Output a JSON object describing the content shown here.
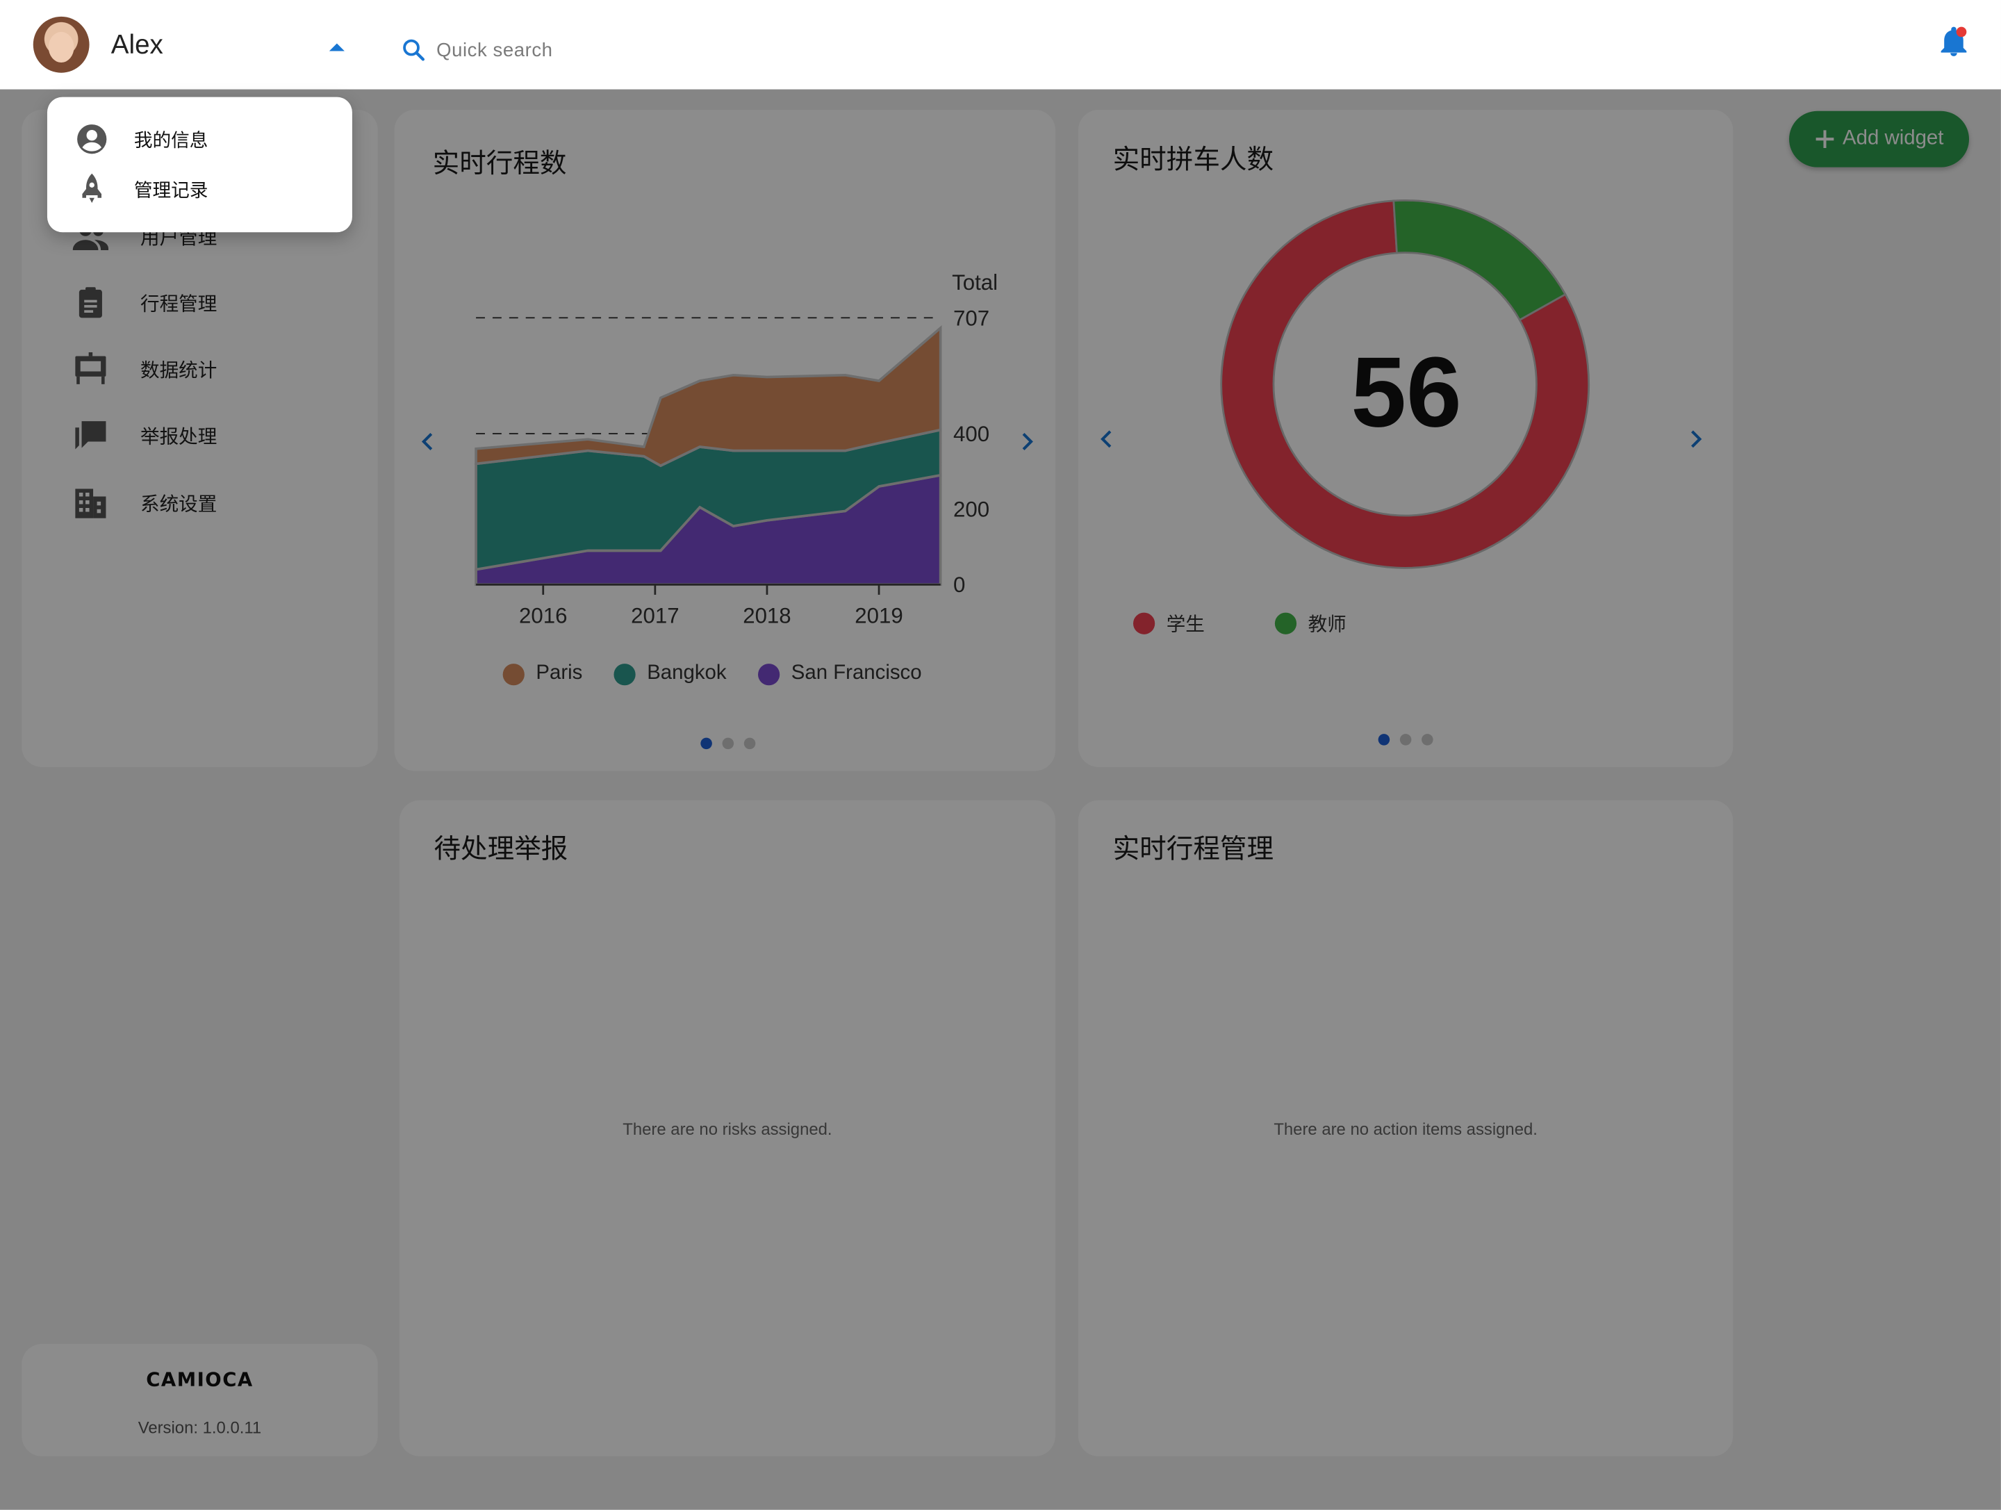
{
  "header": {
    "user_name": "Alex",
    "search_placeholder": "Quick search",
    "notification_dot_color": "#e53935"
  },
  "user_menu": {
    "items": [
      {
        "label": "我的信息",
        "icon": "account-circle-icon"
      },
      {
        "label": "管理记录",
        "icon": "rocket-icon"
      }
    ]
  },
  "sidebar": {
    "items": [
      {
        "label": "用户管理",
        "icon": "people-icon"
      },
      {
        "label": "行程管理",
        "icon": "clipboard-icon"
      },
      {
        "label": "数据统计",
        "icon": "presentation-icon"
      },
      {
        "label": "举报处理",
        "icon": "chat-icon"
      },
      {
        "label": "系统设置",
        "icon": "building-icon"
      }
    ],
    "footer": {
      "brand": "CAMIOCA",
      "version": "Version: 1.0.0.11"
    }
  },
  "add_widget_label": "Add widget",
  "widgets": {
    "trips": {
      "title": "实时行程数"
    },
    "carpool": {
      "title": "实时拼车人数",
      "center_value": "56"
    },
    "reports": {
      "title": "待处理举报",
      "empty_message": "There are no risks assigned."
    },
    "trip_management": {
      "title": "实时行程管理",
      "empty_message": "There are no action items assigned."
    }
  },
  "chart_data": [
    {
      "type": "area",
      "stacked": true,
      "x": [
        2015.4,
        2016.4,
        2016.9,
        2017.05,
        2017.4,
        2017.7,
        2018.0,
        2018.7,
        2019.0,
        2019.55
      ],
      "categories_ticks": [
        "2016",
        "2017",
        "2018",
        "2019"
      ],
      "x_ticks": [
        2016,
        2017,
        2018,
        2019
      ],
      "series": [
        {
          "name": "San Francisco",
          "color": "#7b4bd0",
          "values": [
            40,
            90,
            90,
            90,
            205,
            155,
            170,
            195,
            260,
            290
          ]
        },
        {
          "name": "Bangkok",
          "color": "#2e9c8f",
          "values": [
            280,
            265,
            250,
            225,
            160,
            200,
            185,
            160,
            115,
            120
          ]
        },
        {
          "name": "Paris",
          "color": "#d58b5d",
          "values": [
            40,
            30,
            25,
            180,
            175,
            200,
            195,
            200,
            165,
            270
          ]
        }
      ],
      "ylabel": "Total",
      "y_ticks": [
        0,
        200,
        400,
        707
      ],
      "ylim": [
        0,
        707
      ],
      "reference_lines": [
        707,
        400
      ],
      "legend_position": "bottom"
    },
    {
      "type": "pie",
      "donut": true,
      "center_label": "56",
      "series": [
        {
          "name": "学生",
          "value": 46,
          "color": "#ef4150"
        },
        {
          "name": "教师",
          "value": 10,
          "color": "#43b549"
        }
      ],
      "legend_position": "bottom-left"
    }
  ]
}
